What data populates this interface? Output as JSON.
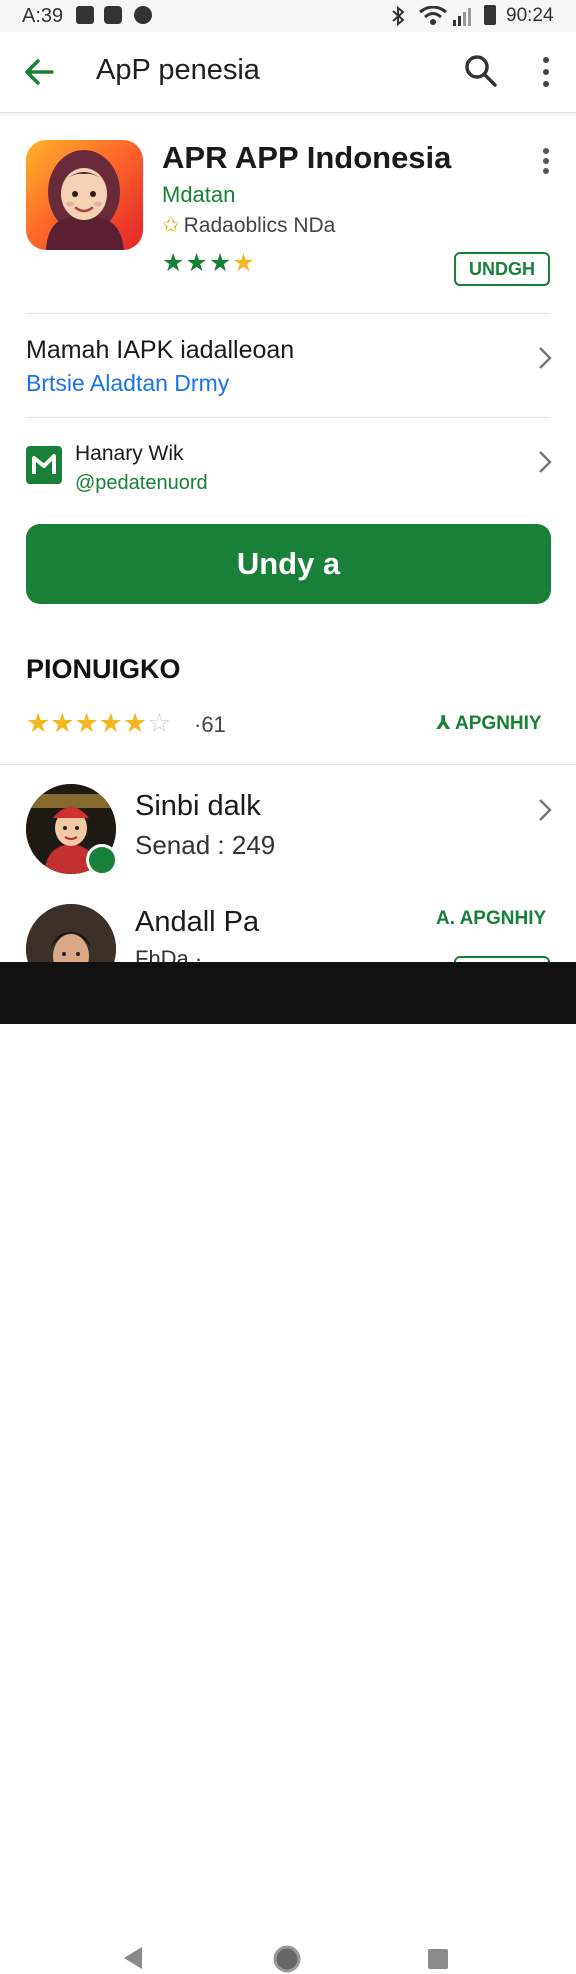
{
  "status_bar": {
    "time": "A:39",
    "battery": "90:24"
  },
  "app_bar": {
    "title": "ApP penesia"
  },
  "app": {
    "name": "APR  APP Indonesia",
    "developer": "Mdatan",
    "badge": "Radaoblics NDa",
    "rating_stars": 3.5,
    "install_label": "UNDGH"
  },
  "row1": {
    "title": "Mamah IAPK iadalleoan",
    "subtitle": "Brtsie Aladtan Drmy"
  },
  "row2": {
    "title": "Hanary Wik",
    "subtitle": "@pedatenuord"
  },
  "main_button": {
    "label": "Undy a"
  },
  "reviews_section": {
    "title": "PIONUIGKO",
    "rating_stars": 4.5,
    "count": "·61",
    "action_label": "APGNHIY"
  },
  "reviews": [
    {
      "name": "Sinbi dalk",
      "meta": "Senad : 249"
    },
    {
      "name": "Andall Pa",
      "meta": "FhDa · ...",
      "action_label": "APGNHIY"
    }
  ],
  "colors": {
    "accent": "#188038",
    "link": "#1a73e8",
    "star": "#f2b823"
  }
}
